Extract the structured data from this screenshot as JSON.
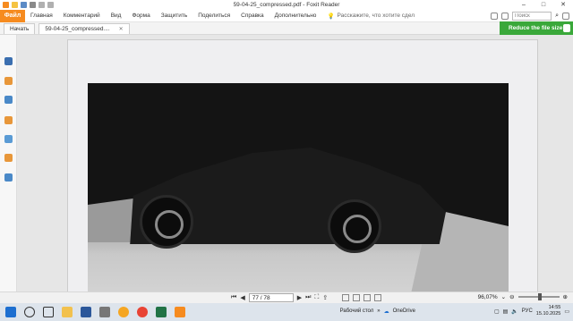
{
  "window": {
    "title": "59-04-25_compressed.pdf - Foxit Reader"
  },
  "qat": {
    "icons": [
      "foxit-logo-icon",
      "open-icon",
      "save-icon",
      "print-icon",
      "undo-icon",
      "redo-icon"
    ]
  },
  "menu": {
    "file_label": "Файл",
    "items": [
      "Главная",
      "Комментарий",
      "Вид",
      "Форма",
      "Защитить",
      "Поделиться",
      "Справка",
      "Дополнительно"
    ],
    "tell_me": "Расскажите, что хотите сдел",
    "search_placeholder": "Поиск"
  },
  "tabs": [
    {
      "label": "Начать",
      "active": false
    },
    {
      "label": "59-04-25_compressed....",
      "active": true
    }
  ],
  "promo": {
    "label": "Reduce the file size"
  },
  "navigation": {
    "page_display": "77 / 78",
    "zoom": "96,07%"
  },
  "taskbar": {
    "desktop_label": "Рабочий стол",
    "onedrive_label": "OneDrive",
    "lang": "РУС",
    "time": "14:55",
    "date": "15.10.2025"
  },
  "colors": {
    "accent": "#f68b1f",
    "promo": "#3aa83a",
    "photo": "#141414"
  }
}
